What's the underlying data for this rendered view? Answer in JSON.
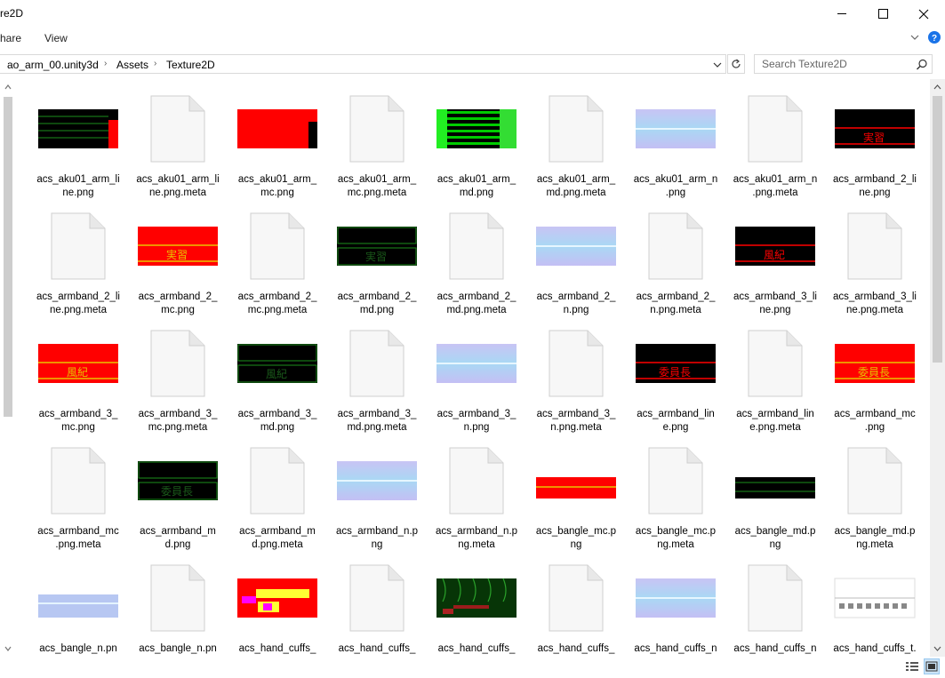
{
  "window": {
    "title": "re2D",
    "minimize_glyph": "—",
    "close_glyph": "✕"
  },
  "ribbon": {
    "share_label": "hare",
    "view_label": "View",
    "expand_icon": "chevron-down-icon",
    "help_icon": "help-icon"
  },
  "address": {
    "crumbs": [
      "ao_arm_00.unity3d",
      "Assets",
      "Texture2D"
    ],
    "dropdown_icon": "chevron-down-icon",
    "refresh_icon": "refresh-icon"
  },
  "search": {
    "placeholder": "Search Texture2D",
    "icon": "search-icon"
  },
  "files": [
    {
      "name": "acs_aku01_arm_line.png",
      "line1": "acs_aku01_arm_li",
      "line2": "ne.png",
      "thumb": "aku_line"
    },
    {
      "name": "acs_aku01_arm_line.png.meta",
      "line1": "acs_aku01_arm_li",
      "line2": "ne.png.meta",
      "thumb": "file"
    },
    {
      "name": "acs_aku01_arm_mc.png",
      "line1": "acs_aku01_arm_",
      "line2": "mc.png",
      "thumb": "aku_mc"
    },
    {
      "name": "acs_aku01_arm_mc.png.meta",
      "line1": "acs_aku01_arm_",
      "line2": "mc.png.meta",
      "thumb": "file"
    },
    {
      "name": "acs_aku01_arm_md.png",
      "line1": "acs_aku01_arm_",
      "line2": "md.png",
      "thumb": "aku_md"
    },
    {
      "name": "acs_aku01_arm_md.png.meta",
      "line1": "acs_aku01_arm_",
      "line2": "md.png.meta",
      "thumb": "file"
    },
    {
      "name": "acs_aku01_arm_n.png",
      "line1": "acs_aku01_arm_n",
      "line2": ".png",
      "thumb": "normal"
    },
    {
      "name": "acs_aku01_arm_n.png.meta",
      "line1": "acs_aku01_arm_n",
      "line2": ".png.meta",
      "thumb": "file"
    },
    {
      "name": "acs_armband_2_line.png",
      "line1": "acs_armband_2_li",
      "line2": "ne.png",
      "thumb": "band_line",
      "glyph": "実習"
    },
    {
      "name": "acs_armband_2_line.png.meta",
      "line1": "acs_armband_2_li",
      "line2": "ne.png.meta",
      "thumb": "file"
    },
    {
      "name": "acs_armband_2_mc.png",
      "line1": "acs_armband_2_",
      "line2": "mc.png",
      "thumb": "band_mc",
      "glyph": "実習"
    },
    {
      "name": "acs_armband_2_mc.png.meta",
      "line1": "acs_armband_2_",
      "line2": "mc.png.meta",
      "thumb": "file"
    },
    {
      "name": "acs_armband_2_md.png",
      "line1": "acs_armband_2_",
      "line2": "md.png",
      "thumb": "band_md",
      "glyph": "実習"
    },
    {
      "name": "acs_armband_2_md.png.meta",
      "line1": "acs_armband_2_",
      "line2": "md.png.meta",
      "thumb": "file"
    },
    {
      "name": "acs_armband_2_n.png",
      "line1": "acs_armband_2_",
      "line2": "n.png",
      "thumb": "normal"
    },
    {
      "name": "acs_armband_2_n.png.meta",
      "line1": "acs_armband_2_",
      "line2": "n.png.meta",
      "thumb": "file"
    },
    {
      "name": "acs_armband_3_line.png",
      "line1": "acs_armband_3_li",
      "line2": "ne.png",
      "thumb": "band_line",
      "glyph": "風紀"
    },
    {
      "name": "acs_armband_3_line.png.meta",
      "line1": "acs_armband_3_li",
      "line2": "ne.png.meta",
      "thumb": "file"
    },
    {
      "name": "acs_armband_3_mc.png",
      "line1": "acs_armband_3_",
      "line2": "mc.png",
      "thumb": "band_mc",
      "glyph": "風紀"
    },
    {
      "name": "acs_armband_3_mc.png.meta",
      "line1": "acs_armband_3_",
      "line2": "mc.png.meta",
      "thumb": "file"
    },
    {
      "name": "acs_armband_3_md.png",
      "line1": "acs_armband_3_",
      "line2": "md.png",
      "thumb": "band_md",
      "glyph": "風紀"
    },
    {
      "name": "acs_armband_3_md.png.meta",
      "line1": "acs_armband_3_",
      "line2": "md.png.meta",
      "thumb": "file"
    },
    {
      "name": "acs_armband_3_n.png",
      "line1": "acs_armband_3_",
      "line2": "n.png",
      "thumb": "normal"
    },
    {
      "name": "acs_armband_3_n.png.meta",
      "line1": "acs_armband_3_",
      "line2": "n.png.meta",
      "thumb": "file"
    },
    {
      "name": "acs_armband_line.png",
      "line1": "acs_armband_lin",
      "line2": "e.png",
      "thumb": "band_line",
      "glyph": "委員長"
    },
    {
      "name": "acs_armband_line.png.meta",
      "line1": "acs_armband_lin",
      "line2": "e.png.meta",
      "thumb": "file"
    },
    {
      "name": "acs_armband_mc.png",
      "line1": "acs_armband_mc",
      "line2": ".png",
      "thumb": "band_mc",
      "glyph": "委員長"
    },
    {
      "name": "acs_armband_mc.png.meta",
      "line1": "acs_armband_mc",
      "line2": ".png.meta",
      "thumb": "file"
    },
    {
      "name": "acs_armband_md.png",
      "line1": "acs_armband_m",
      "line2": "d.png",
      "thumb": "band_md",
      "glyph": "委員長"
    },
    {
      "name": "acs_armband_md.png.meta",
      "line1": "acs_armband_m",
      "line2": "d.png.meta",
      "thumb": "file"
    },
    {
      "name": "acs_armband_n.png",
      "line1": "acs_armband_n.p",
      "line2": "ng",
      "thumb": "normal"
    },
    {
      "name": "acs_armband_n.png.meta",
      "line1": "acs_armband_n.p",
      "line2": "ng.meta",
      "thumb": "file"
    },
    {
      "name": "acs_bangle_mc.png",
      "line1": "acs_bangle_mc.p",
      "line2": "ng",
      "thumb": "bangle_mc"
    },
    {
      "name": "acs_bangle_mc.png.meta",
      "line1": "acs_bangle_mc.p",
      "line2": "ng.meta",
      "thumb": "file"
    },
    {
      "name": "acs_bangle_md.png",
      "line1": "acs_bangle_md.p",
      "line2": "ng",
      "thumb": "bangle_md"
    },
    {
      "name": "acs_bangle_md.png.meta",
      "line1": "acs_bangle_md.p",
      "line2": "ng.meta",
      "thumb": "file"
    },
    {
      "name": "acs_bangle_n.png",
      "line1": "acs_bangle_n.pn",
      "line2": "",
      "thumb": "bangle_n"
    },
    {
      "name": "acs_bangle_n.png.meta",
      "line1": "acs_bangle_n.pn",
      "line2": "",
      "thumb": "file"
    },
    {
      "name": "acs_hand_cuffs_mc",
      "line1": "acs_hand_cuffs_",
      "line2": "",
      "thumb": "cuffs_mc"
    },
    {
      "name": "acs_hand_cuffs_mc.meta",
      "line1": "acs_hand_cuffs_",
      "line2": "",
      "thumb": "file"
    },
    {
      "name": "acs_hand_cuffs_md",
      "line1": "acs_hand_cuffs_",
      "line2": "",
      "thumb": "cuffs_md"
    },
    {
      "name": "acs_hand_cuffs_md.meta",
      "line1": "acs_hand_cuffs_",
      "line2": "",
      "thumb": "file"
    },
    {
      "name": "acs_hand_cuffs_n",
      "line1": "acs_hand_cuffs_n",
      "line2": "",
      "thumb": "normal"
    },
    {
      "name": "acs_hand_cuffs_n.meta",
      "line1": "acs_hand_cuffs_n",
      "line2": "",
      "thumb": "file"
    },
    {
      "name": "acs_hand_cuffs_t",
      "line1": "acs_hand_cuffs_t.",
      "line2": "",
      "thumb": "cuffs_t"
    }
  ],
  "statusbar": {
    "details_view_icon": "details-view-icon",
    "large_icons_view_icon": "large-icons-view-icon"
  },
  "colors": {
    "red": "#ff0000",
    "green": "#00cc00",
    "gold": "#e8c400",
    "selected_view": "#cce4f7"
  }
}
